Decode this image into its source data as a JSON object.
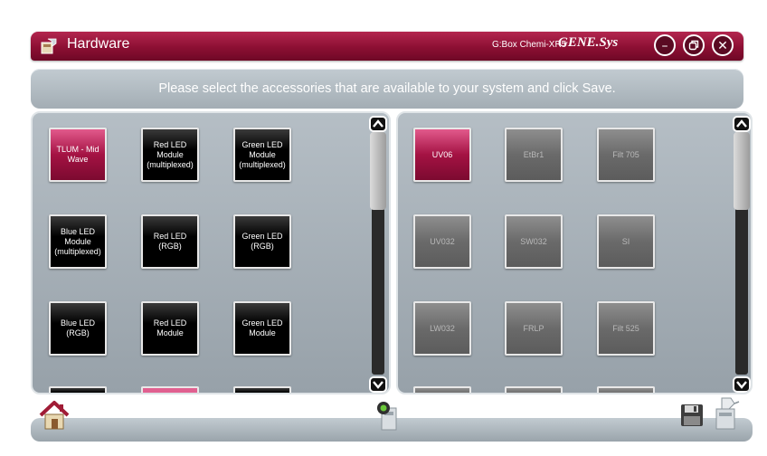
{
  "titlebar": {
    "title": "Hardware",
    "device": "G:Box Chemi-XR5",
    "brand": "GENE.Sys",
    "buttons": [
      "minimize",
      "restore",
      "close"
    ]
  },
  "instruction": "Please select the accessories that are available to your system and click Save.",
  "left_panel": {
    "tiles": [
      {
        "label": "TLUM - Mid Wave",
        "selected": true
      },
      {
        "label": "Red LED Module (multiplexed)",
        "selected": false
      },
      {
        "label": "Green LED Module (multiplexed)",
        "selected": false
      },
      {
        "label": "Blue LED Module (multiplexed)",
        "selected": false
      },
      {
        "label": "Red LED (RGB)",
        "selected": false
      },
      {
        "label": "Green LED (RGB)",
        "selected": false
      },
      {
        "label": "Blue LED (RGB)",
        "selected": false
      },
      {
        "label": "Red LED Module",
        "selected": false
      },
      {
        "label": "Green LED Module",
        "selected": false
      }
    ]
  },
  "right_panel": {
    "tiles": [
      {
        "label": "UV06",
        "selected": true
      },
      {
        "label": "EtBr1",
        "selected": false
      },
      {
        "label": "Filt 705",
        "selected": false
      },
      {
        "label": "UV032",
        "selected": false
      },
      {
        "label": "SW032",
        "selected": false
      },
      {
        "label": "SI",
        "selected": false
      },
      {
        "label": "LW032",
        "selected": false
      },
      {
        "label": "FRLP",
        "selected": false
      },
      {
        "label": "Filt 525",
        "selected": false
      }
    ]
  },
  "icons": {
    "app": "hardware-icon",
    "home": "home-icon",
    "center": "device-status-icon",
    "save": "save-disk-icon",
    "exit": "exit-icon"
  },
  "colors": {
    "accent": "#8c0f33",
    "selected_tile": "#a41243",
    "panel": "#a8b1b8"
  }
}
